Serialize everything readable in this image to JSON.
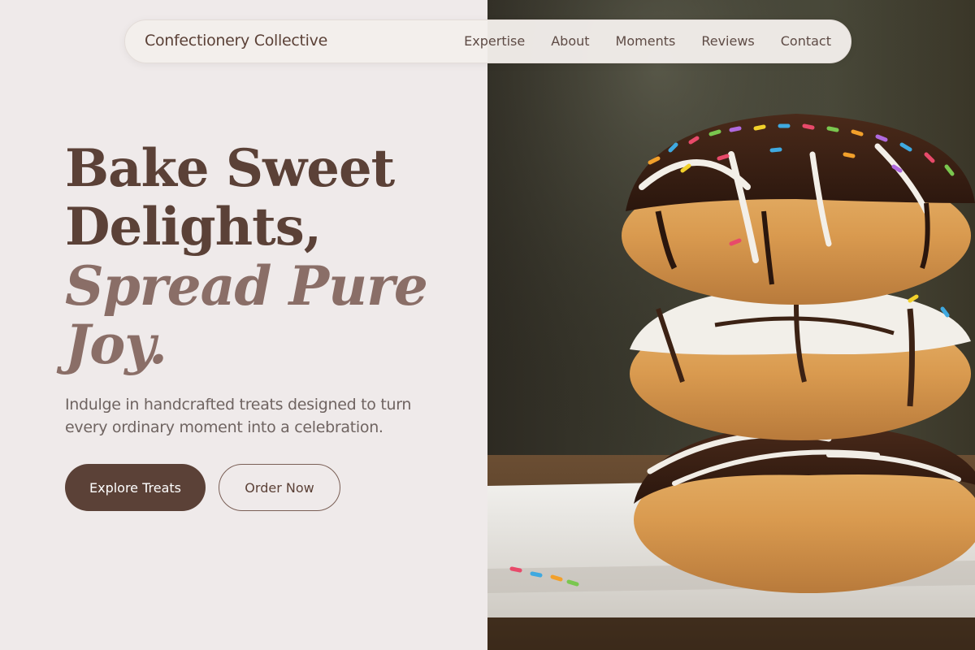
{
  "nav": {
    "brand": "Confectionery Collective",
    "links": [
      "Expertise",
      "About",
      "Moments",
      "Reviews",
      "Contact"
    ]
  },
  "hero": {
    "headline_line1": "Bake Sweet",
    "headline_line2": "Delights,",
    "headline_accent_line1": "Spread Pure",
    "headline_accent_line2": "Joy.",
    "subtitle": "Indulge in handcrafted treats designed to turn every ordinary moment into a celebration.",
    "primary_button": "Explore Treats",
    "secondary_button": "Order Now"
  },
  "colors": {
    "background": "#efeaea",
    "primary": "#5b4137",
    "accent": "#8a6e67",
    "text_muted": "#6f6461"
  }
}
